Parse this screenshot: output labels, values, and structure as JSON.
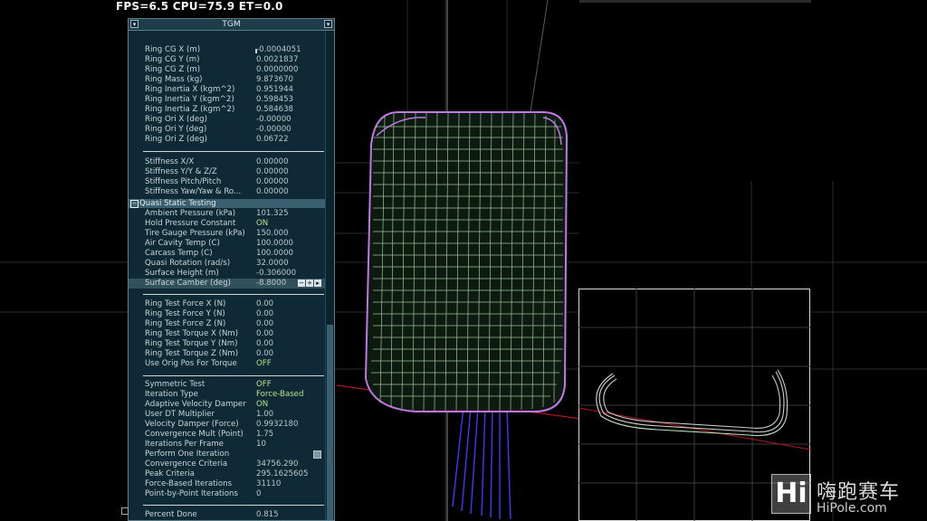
{
  "hud": {
    "stats": "FPS=6.5 CPU=75.9 ET=0.0"
  },
  "panel": {
    "title": "TGM",
    "btn_left": "▾",
    "btn_right": "▾",
    "ring": [
      {
        "label": "Ring CG X (m)",
        "value": "-0.0004051"
      },
      {
        "label": "Ring CG Y (m)",
        "value": "0.0021837"
      },
      {
        "label": "Ring CG Z (m)",
        "value": "0.0000000"
      },
      {
        "label": "Ring Mass (kg)",
        "value": "9.873670"
      },
      {
        "label": "Ring Inertia X (kgm^2)",
        "value": "0.951944"
      },
      {
        "label": "Ring Inertia Y (kgm^2)",
        "value": "0.598453"
      },
      {
        "label": "Ring Inertia Z (kgm^2)",
        "value": "0.584638"
      },
      {
        "label": "Ring Ori X (deg)",
        "value": "-0.00000"
      },
      {
        "label": "Ring Ori Y (deg)",
        "value": "-0.00000"
      },
      {
        "label": "Ring Ori Z (deg)",
        "value": "0.06722"
      }
    ],
    "stiffness": [
      {
        "label": "Stiffness X/X",
        "value": "0.00000"
      },
      {
        "label": "Stiffness Y/Y & Z/Z",
        "value": "0.00000"
      },
      {
        "label": "Stiffness Pitch/Pitch",
        "value": "0.00000"
      },
      {
        "label": "Stiffness Yaw/Yaw & Ro...",
        "value": "0.00000"
      }
    ],
    "section_title": "Quasi Static Testing",
    "section_toggle": "−",
    "quasi": [
      {
        "label": "Ambient Pressure (kPa)",
        "value": "101.325"
      },
      {
        "label": "Hold Pressure Constant",
        "value": "ON"
      },
      {
        "label": "Tire Gauge Pressure (kPa)",
        "value": "150.000"
      },
      {
        "label": "Air Cavity Temp (C)",
        "value": "100.0000"
      },
      {
        "label": "Carcass Temp (C)",
        "value": "100.0000"
      },
      {
        "label": "Quasi Rotation (rad/s)",
        "value": "32.0000"
      },
      {
        "label": "Surface Height (m)",
        "value": "-0.306000"
      },
      {
        "label": "Surface Camber (deg)",
        "value": "-8.8000"
      }
    ],
    "spin_minus": "−",
    "spin_plus": "+",
    "spin_step": "▸",
    "ring_test": [
      {
        "label": "Ring Test Force X (N)",
        "value": "0.00"
      },
      {
        "label": "Ring Test Force Y (N)",
        "value": "0.00"
      },
      {
        "label": "Ring Test Force Z (N)",
        "value": "0.00"
      },
      {
        "label": "Ring Test Torque X (Nm)",
        "value": "0.00"
      },
      {
        "label": "Ring Test Torque Y (Nm)",
        "value": "0.00"
      },
      {
        "label": "Ring Test Torque Z (Nm)",
        "value": "0.00"
      },
      {
        "label": "Use Orig Pos For Torque",
        "value": "OFF"
      }
    ],
    "solver": [
      {
        "label": "Symmetric Test",
        "value": "OFF"
      },
      {
        "label": "Iteration Type",
        "value": "Force-Based"
      },
      {
        "label": "Adaptive Velocity Damper",
        "value": "ON"
      },
      {
        "label": "User DT Multiplier",
        "value": "1.00"
      },
      {
        "label": "Velocity Damper (Force)",
        "value": "0.9932180"
      },
      {
        "label": "Convergence Mult (Point)",
        "value": "1.75"
      },
      {
        "label": "Iterations Per Frame",
        "value": "10"
      },
      {
        "label": "Perform One Iteration",
        "value": ""
      },
      {
        "label": "Convergence Criteria",
        "value": "34756.290"
      },
      {
        "label": "Peak Criteria",
        "value": "295.1625605"
      },
      {
        "label": "Force-Based Iterations",
        "value": "31110"
      },
      {
        "label": "Point-by-Point Iterations",
        "value": "0"
      }
    ],
    "footer": {
      "label": "Percent Done",
      "value": "0.815"
    }
  },
  "watermark": {
    "logo": "Hi",
    "chinese": "嗨跑赛车",
    "url": "HiPole.com"
  }
}
